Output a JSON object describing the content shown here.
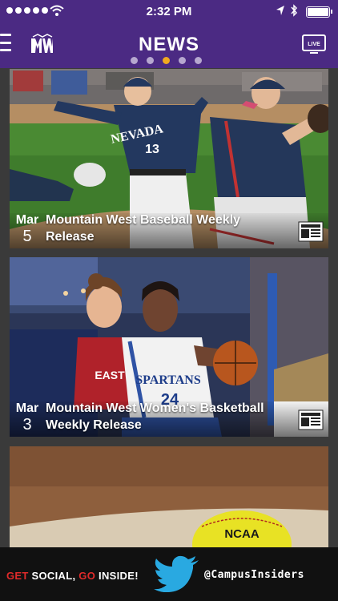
{
  "status_bar": {
    "time": "2:32 PM",
    "signal_icon": "signal-dots-icon",
    "wifi_icon": "wifi-icon",
    "location_icon": "location-arrow-icon",
    "bluetooth_icon": "bluetooth-icon",
    "battery_icon": "battery-icon",
    "battery_level": 1.0
  },
  "header": {
    "title": "NEWS",
    "menu_icon": "hamburger-menu-icon",
    "logo_icon": "mountain-west-logo-icon",
    "live_icon": "live-tv-icon",
    "live_label": "LIVE",
    "page_count": 5,
    "active_page": 3,
    "brand_color": "#4b2a83",
    "active_dot_color": "#f0a820"
  },
  "feed": {
    "items": [
      {
        "month": "Mar",
        "day": "5",
        "headline": "Mountain West Baseball Weekly Release",
        "type_icon": "news-article-icon"
      },
      {
        "month": "Mar",
        "day": "3",
        "headline": "Mountain West Women's Basketball Weekly Release",
        "type_icon": "news-article-icon"
      },
      {
        "month": "",
        "day": "",
        "headline": "",
        "type_icon": ""
      }
    ]
  },
  "photo_text": {
    "jersey_nevada": "NEVADA",
    "jersey_number": "13",
    "jersey_spartans": "SPARTANS",
    "jersey_number_2": "24",
    "jersey_east": "EAST",
    "ball_ncaa": "NCAA"
  },
  "banner": {
    "get": "GET ",
    "social": "SOCIAL, ",
    "go": "GO ",
    "inside": "INSIDE!",
    "twitter_icon": "twitter-bird-icon",
    "handle": "@CampusInsiders",
    "accent_color": "#e02a2a",
    "twitter_color": "#29a9e1"
  }
}
